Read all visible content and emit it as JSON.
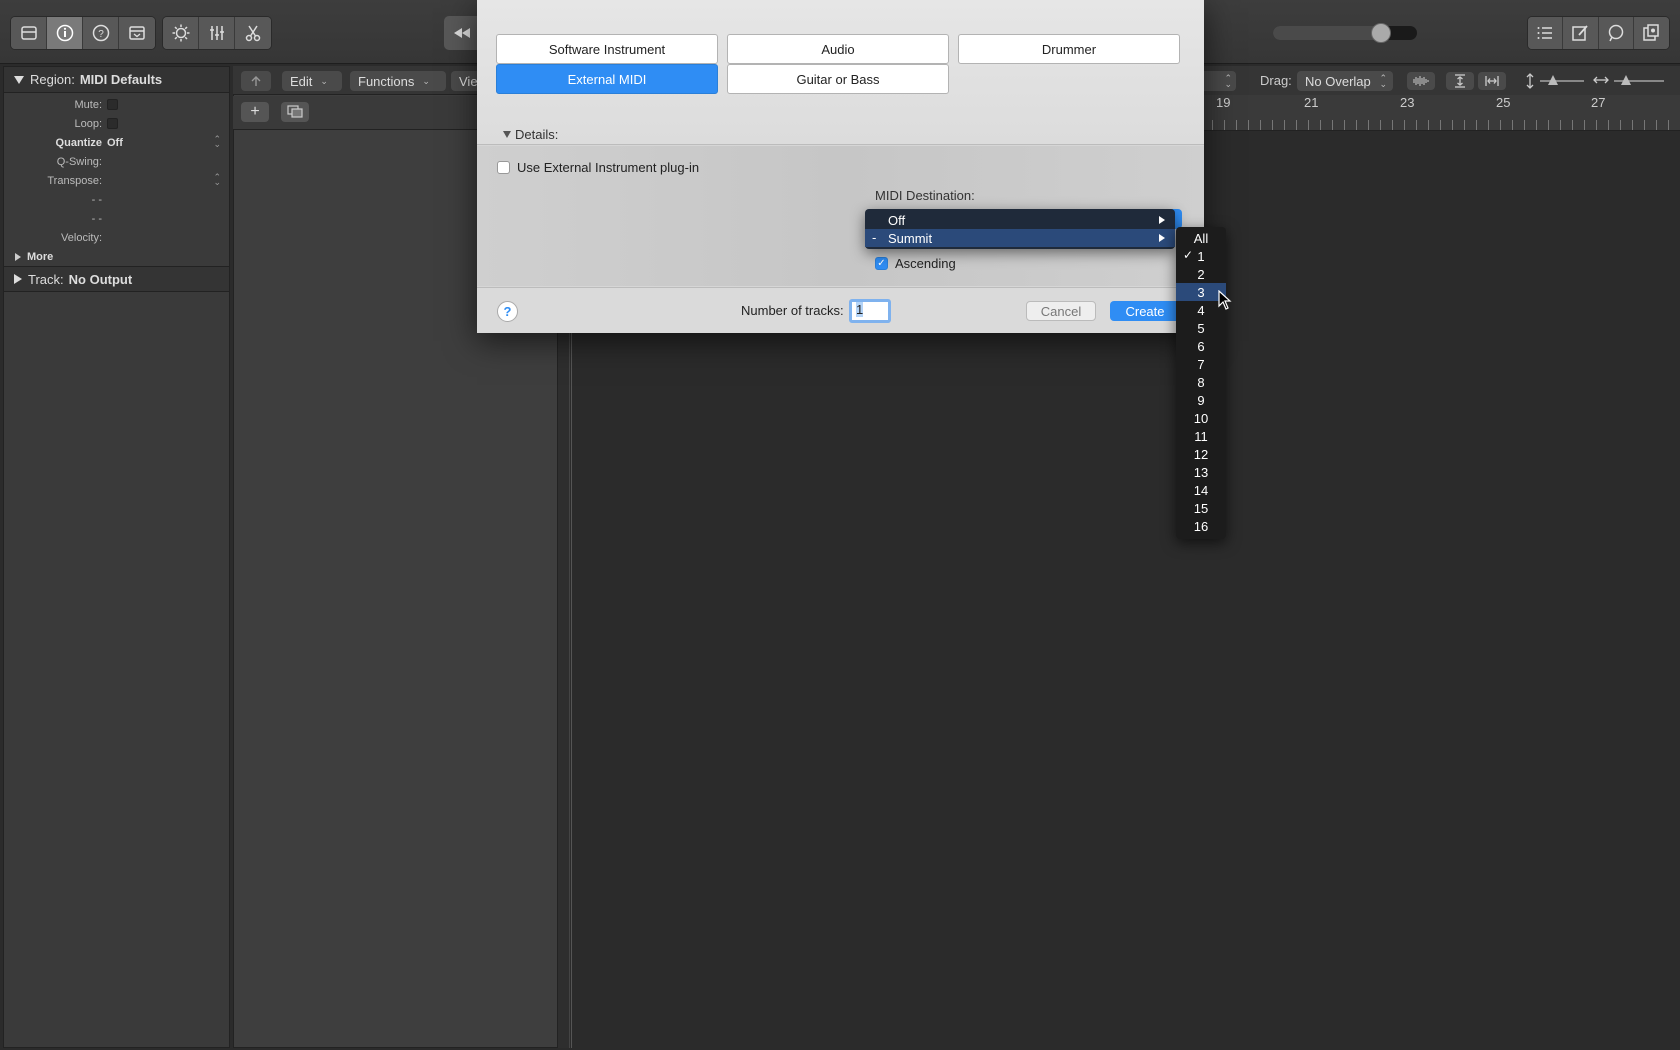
{
  "colors": {
    "accent": "#2f8df4",
    "menu_highlight": "#2b4a7a"
  },
  "toolbar": {
    "left_icons": [
      "library-icon",
      "inspector-icon",
      "quick-help-icon",
      "toolbar-icon"
    ],
    "mid_icons": [
      "smart-controls-icon",
      "mixer-icon",
      "editors-icon"
    ],
    "right_icons": [
      "list-editors-icon",
      "notepad-icon",
      "loop-browser-icon",
      "browser-icon"
    ],
    "volume_fraction": 0.75
  },
  "inspector": {
    "region_label": "Region:",
    "region_name": "MIDI Defaults",
    "mute_label": "Mute:",
    "loop_label": "Loop:",
    "quantize_label": "Quantize",
    "quantize_value": "Off",
    "qswing_label": "Q-Swing:",
    "transpose_label": "Transpose:",
    "dash1": "- -",
    "dash2": "- -",
    "velocity_label": "Velocity:",
    "more_label": "More",
    "track_label": "Track:",
    "track_value": "No Output"
  },
  "tracks_menu": {
    "edit": "Edit",
    "functions": "Functions",
    "view": "View"
  },
  "drag": {
    "label": "Drag:",
    "value": "No Overlap"
  },
  "ruler": {
    "numbers": [
      "19",
      "21",
      "23",
      "25",
      "27"
    ]
  },
  "dialog": {
    "types": {
      "software_instrument": "Software Instrument",
      "audio": "Audio",
      "drummer": "Drummer",
      "external_midi": "External MIDI",
      "guitar_or_bass": "Guitar or Bass"
    },
    "details_label": "Details:",
    "use_external_plugin": "Use External Instrument plug-in",
    "midi_destination_label": "MIDI Destination:",
    "ascending_label": "Ascending",
    "num_tracks_label": "Number of tracks:",
    "num_tracks_value": "1",
    "cancel": "Cancel",
    "create": "Create",
    "help": "?"
  },
  "dest_menu": {
    "items": [
      {
        "label": "Off",
        "prefix": ""
      },
      {
        "label": "Summit",
        "prefix": "-"
      }
    ]
  },
  "channel_menu": {
    "items": [
      "All",
      "1",
      "2",
      "3",
      "4",
      "5",
      "6",
      "7",
      "8",
      "9",
      "10",
      "11",
      "12",
      "13",
      "14",
      "15",
      "16"
    ],
    "checked": "1",
    "highlighted": "3"
  }
}
